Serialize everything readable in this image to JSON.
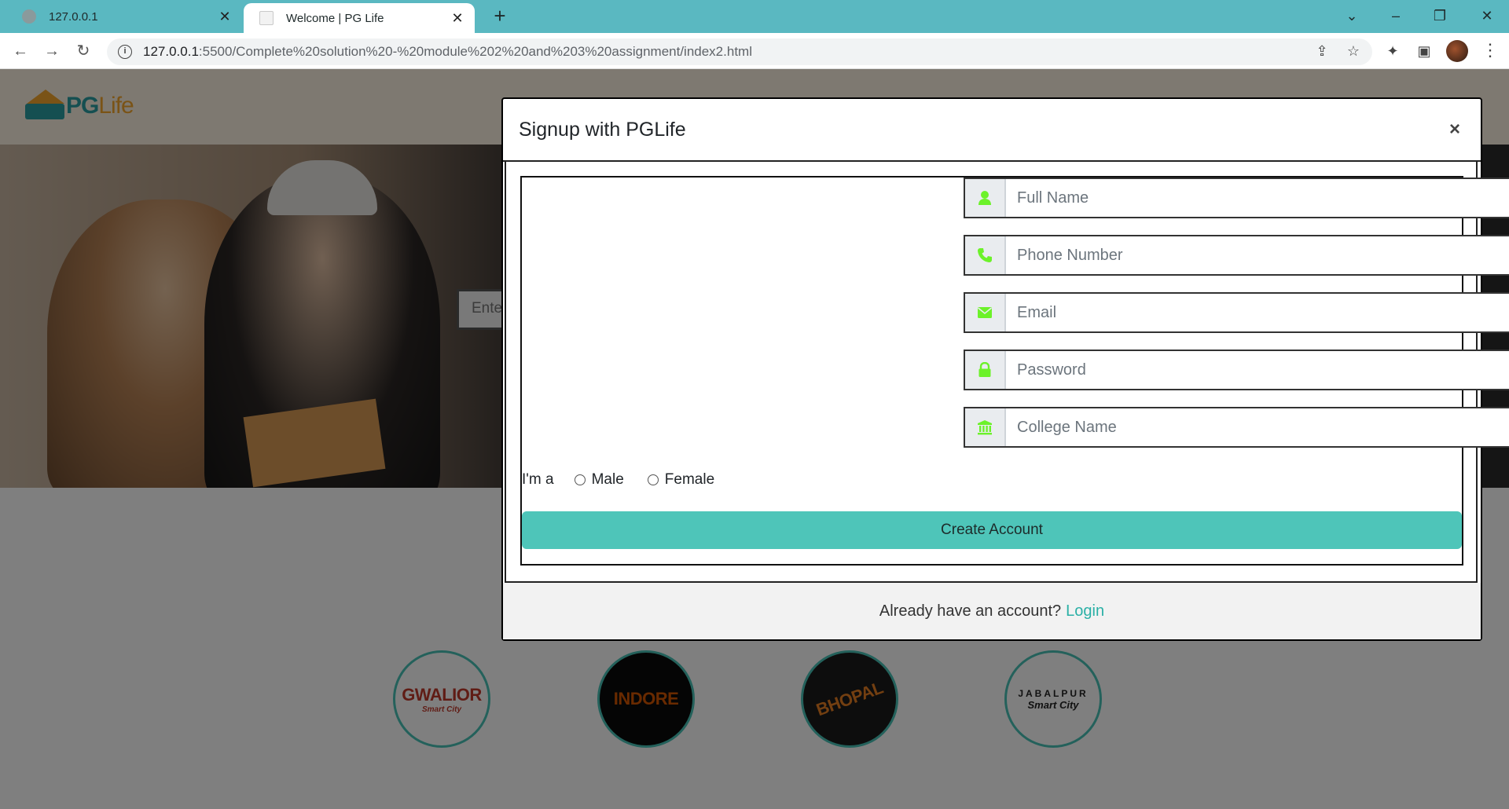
{
  "browser": {
    "tabs": [
      {
        "label": "127.0.0.1",
        "active": false
      },
      {
        "label": "Welcome | PG Life",
        "active": true
      }
    ],
    "url_host": "127.0.0.1",
    "url_path": ":5500/Complete%20solution%20-%20module%202%20and%203%20assignment/index2.html"
  },
  "site": {
    "logo_pg": "PG",
    "logo_life": "Life",
    "search_placeholder": "Ente"
  },
  "cities": [
    {
      "name": "GWALIOR",
      "sub": "Smart City"
    },
    {
      "name": "INDORE",
      "sub": ""
    },
    {
      "name": "BHOPAL",
      "sub": ""
    },
    {
      "name": "JABALPUR",
      "sub": "Smart City"
    }
  ],
  "modal": {
    "title": "Signup with PGLife",
    "close": "×",
    "fields": [
      {
        "placeholder": "Full Name",
        "icon": "user-icon"
      },
      {
        "placeholder": "Phone Number",
        "icon": "phone-icon"
      },
      {
        "placeholder": "Email",
        "icon": "envelope-icon"
      },
      {
        "placeholder": "Password",
        "icon": "lock-icon"
      },
      {
        "placeholder": "College Name",
        "icon": "university-icon"
      }
    ],
    "gender_label": "I'm a",
    "gender_options": [
      "Male",
      "Female"
    ],
    "submit": "Create Account",
    "footer_text": "Already have an account?",
    "footer_link": "Login"
  },
  "colors": {
    "icon_green": "#6cf22a",
    "accent_teal": "#4ec5b9",
    "link_teal": "#2ab0a6"
  }
}
